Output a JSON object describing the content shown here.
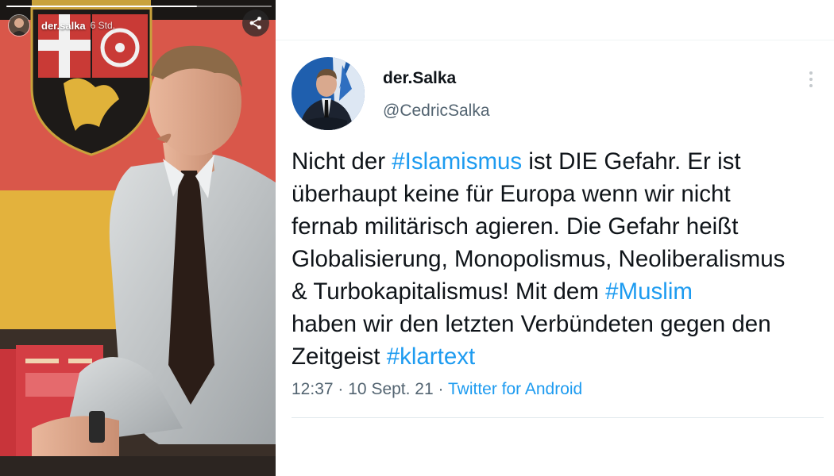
{
  "story": {
    "username": "der.salka",
    "time_ago": "6 Std.",
    "progress": 0.72,
    "share_icon": "share-icon"
  },
  "tweet": {
    "display_name": "der.Salka",
    "handle": "@CedricSalka",
    "text_lines": [
      [
        {
          "t": "Nicht der "
        },
        {
          "t": "#Islamismus",
          "tag": true
        },
        {
          "t": " ist DIE Gefahr. Er ist"
        }
      ],
      [
        {
          "t": "überhaupt keine für Europa wenn wir nicht"
        }
      ],
      [
        {
          "t": "fernab militärisch agieren. Die Gefahr heißt"
        }
      ],
      [
        {
          "t": "Globalisierung, Monopolismus, Neoliberalismus"
        }
      ],
      [
        {
          "t": "& Turbokapitalismus! Mit dem "
        },
        {
          "t": "#Muslim",
          "tag": true
        }
      ],
      [
        {
          "t": "haben wir den letzten Verbündeten gegen den"
        }
      ],
      [
        {
          "t": "Zeitgeist "
        },
        {
          "t": "#klartext",
          "tag": true
        }
      ]
    ],
    "time": "12:37",
    "date": "10 Sept. 21",
    "separator": "·",
    "source": "Twitter for Android",
    "more_icon": "more-vertical-icon"
  },
  "colors": {
    "link": "#1d9bf0",
    "text": "#0f1419",
    "secondary": "#536471"
  }
}
